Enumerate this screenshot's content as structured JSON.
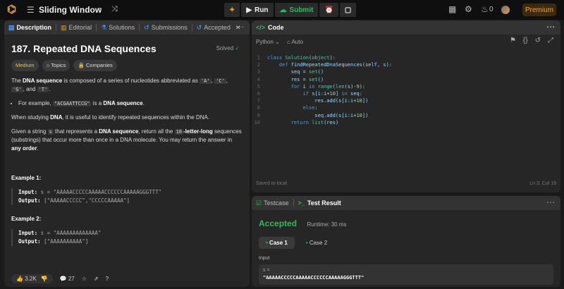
{
  "topbar": {
    "title": "Sliding Window",
    "run_label": "Run",
    "submit_label": "Submit",
    "streak": "0",
    "premium_label": "Premium"
  },
  "left_tabs": [
    "Description",
    "Editorial",
    "Solutions",
    "Submissions",
    "Accepted"
  ],
  "problem": {
    "title": "187. Repeated DNA Sequences",
    "status": "Solved",
    "difficulty": "Medium",
    "topics_label": "Topics",
    "companies_label": "Companies",
    "p1_a": "The ",
    "p1_b": "DNA sequence",
    "p1_c": " is composed of a series of nucleotides abbreviated as ",
    "n_a": "'A'",
    "n_c": "'C'",
    "n_g": "'G'",
    "n_t": "'T'",
    "comma": ", ",
    "and": ", and ",
    "dot": ".",
    "bullet_a": "For example, ",
    "bullet_code": "\"ACGAATTCCG\"",
    "bullet_b": " is a ",
    "bullet_c": "DNA sequence",
    "p2_a": "When studying ",
    "p2_b": "DNA",
    "p2_c": ", it is useful to identify repeated sequences within the DNA.",
    "p3_a": "Given a string ",
    "p3_s": "s",
    "p3_b": " that represents a ",
    "p3_c": "DNA sequence",
    "p3_d": ", return all the ",
    "p3_10": "10",
    "p3_e": "-letter-long",
    "p3_f": " sequences (substrings) that occur more than once in a DNA molecule. You may return the answer in ",
    "p3_g": "any order",
    "examples": [
      {
        "heading": "Example 1:",
        "input": "s = \"AAAAACCCCCAAAAACCCCCCAAAAAGGGTTT\"",
        "output": "[\"AAAAACCCCC\",\"CCCCCAAAAA\"]"
      },
      {
        "heading": "Example 2:",
        "input": "s = \"AAAAAAAAAAAAA\"",
        "output": "[\"AAAAAAAAAA\"]"
      }
    ],
    "input_label": "Input:",
    "output_label": "Output:"
  },
  "footer": {
    "likes": "3.2K",
    "comments": "27"
  },
  "code_panel": {
    "title": "Code",
    "language": "Python",
    "auto_label": "Auto",
    "lines": [
      "class Solution(object):",
      "    def findRepeatedDnaSequences(self, s):",
      "        seq = set()",
      "        res = set()",
      "        for i in range(len(s)-9):",
      "            if s[i:i+10] in seq:",
      "                res.add(s[i:i+10])",
      "            else:",
      "                seq.add(s[i:i+10])",
      "        return list(res)"
    ],
    "saved": "Saved to local",
    "cursor": "Ln 3, Col 19"
  },
  "test_panel": {
    "testcase_tab": "Testcase",
    "result_tab": "Test Result",
    "status": "Accepted",
    "runtime": "Runtime: 30 ms",
    "cases": [
      "Case 1",
      "Case 2"
    ],
    "input_label": "Input",
    "var_label": "s =",
    "var_value": "\"AAAAACCCCCAAAAACCCCCCAAAAAGGGTTT\""
  },
  "colors": {
    "accent": "#ffa116",
    "success": "#2cbb5d",
    "bg": "#1a1a1a",
    "panel": "#262626"
  }
}
